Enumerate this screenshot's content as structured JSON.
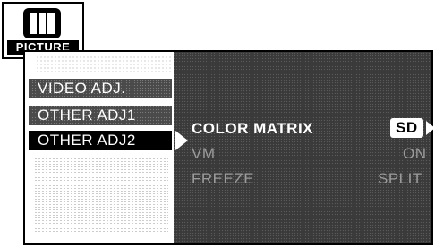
{
  "icon": {
    "label": "PICTURE",
    "glyph": "picture-bars-icon"
  },
  "menu": {
    "items": [
      {
        "label": "VIDEO ADJ.",
        "state": "inactive"
      },
      {
        "label": "OTHER ADJ1",
        "state": "inactive"
      },
      {
        "label": "OTHER ADJ2",
        "state": "selected"
      }
    ]
  },
  "settings": [
    {
      "name": "COLOR MATRIX",
      "value": "SD",
      "highlighted": true
    },
    {
      "name": "VM",
      "value": "ON",
      "highlighted": false
    },
    {
      "name": "FREEZE",
      "value": "SPLIT",
      "highlighted": false
    }
  ],
  "colors": {
    "panel_bg": "#3a3a3a",
    "dim_text": "#9c9c9c",
    "highlight": "#ffffff",
    "selected_bg": "#000000"
  }
}
